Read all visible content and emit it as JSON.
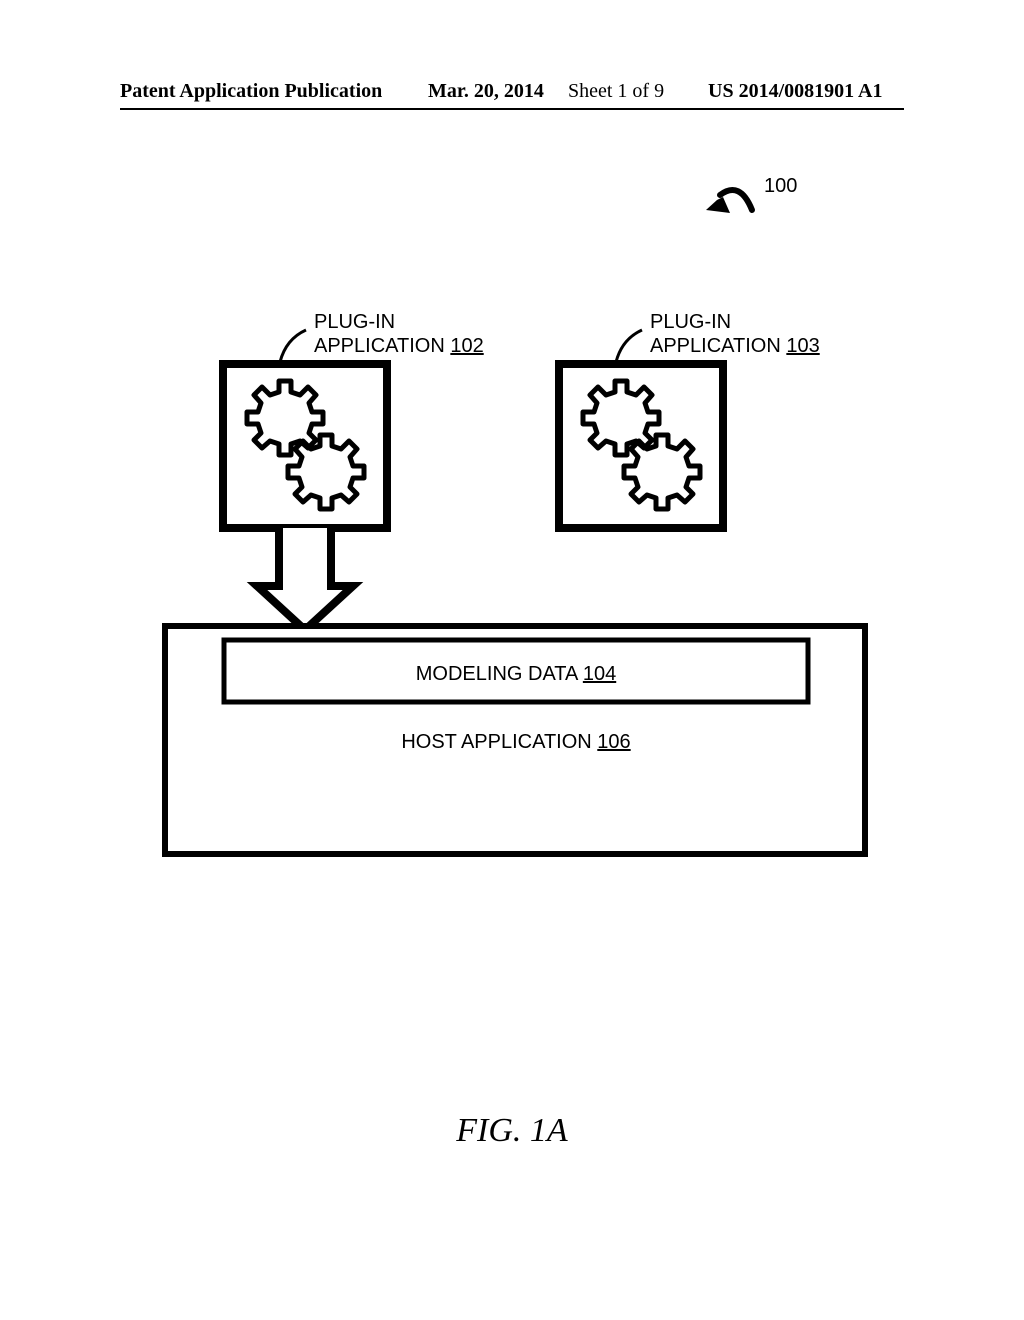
{
  "header": {
    "publication_label": "Patent Application Publication",
    "date": "Mar. 20, 2014",
    "sheet": "Sheet 1 of 9",
    "pub_no": "US 2014/0081901 A1"
  },
  "refs": {
    "figure_ref": "100",
    "plugin_a_label_line1": "PLUG-IN",
    "plugin_a_label_line2": "APPLICATION",
    "plugin_a_num": "102",
    "plugin_b_label_line1": "PLUG-IN",
    "plugin_b_label_line2": "APPLICATION",
    "plugin_b_num": "103",
    "modeling_label": "MODELING DATA",
    "modeling_num": "104",
    "host_label": "HOST APPLICATION",
    "host_num": "106"
  },
  "figure": {
    "caption": "FIG. 1A"
  }
}
